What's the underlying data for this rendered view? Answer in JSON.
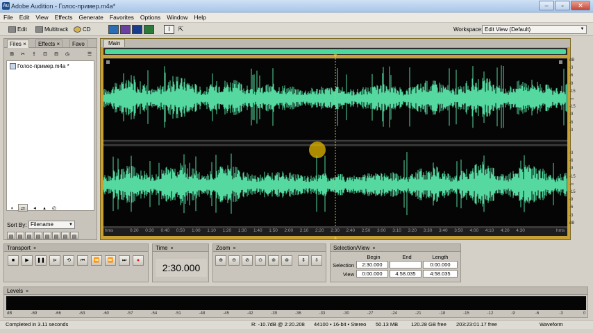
{
  "window": {
    "title": "Adobe Audition - Голос-пример.m4a*"
  },
  "menu": [
    "File",
    "Edit",
    "View",
    "Effects",
    "Generate",
    "Favorites",
    "Options",
    "Window",
    "Help"
  ],
  "toolbar": {
    "edit_label": "Edit",
    "multitrack_label": "Multitrack",
    "cd_label": "CD",
    "workspace_label": "Workspace:",
    "workspace_value": "Edit View (Default)"
  },
  "files_panel": {
    "tabs": [
      "Files",
      "Effects",
      "Favo"
    ],
    "file_name": "Голос-пример.m4a *",
    "sort_label": "Sort By:",
    "sort_value": "Filename"
  },
  "editor": {
    "tab_label": "Main",
    "ruler_unit": "hms",
    "ruler_ticks": [
      "0:20",
      "0:30",
      "0:40",
      "0:50",
      "1:00",
      "1:10",
      "1:20",
      "1:30",
      "1:40",
      "1:50",
      "2:00",
      "2:10",
      "2:20",
      "2:30",
      "2:40",
      "2:50",
      "3:00",
      "3:10",
      "3:20",
      "3:30",
      "3:40",
      "3:50",
      "4:00",
      "4:10",
      "4:20",
      "4:30"
    ],
    "db_labels_top": [
      "dB",
      "-3",
      "-6",
      "-9",
      "-15",
      "-∞",
      "-15",
      "-9",
      "-6",
      "-3"
    ],
    "db_labels_bottom": [
      "-3",
      "-6",
      "-9",
      "-15",
      "-∞",
      "-15",
      "-9",
      "-6",
      "-3",
      "dB"
    ]
  },
  "transport": {
    "title": "Transport"
  },
  "time_panel": {
    "title": "Time",
    "value": "2:30.000"
  },
  "zoom_panel": {
    "title": "Zoom"
  },
  "selection_panel": {
    "title": "Selection/View",
    "col_begin": "Begin",
    "col_end": "End",
    "col_length": "Length",
    "row_selection": "Selection",
    "row_view": "View",
    "selection_begin": "2:30.000",
    "selection_end": "",
    "selection_length": "0:00.000",
    "view_begin": "0:00.000",
    "view_end": "4:58.035",
    "view_length": "4:58.035"
  },
  "levels_panel": {
    "title": "Levels",
    "scale": [
      "dB",
      "-69",
      "-66",
      "-63",
      "-60",
      "-57",
      "-54",
      "-51",
      "-48",
      "-45",
      "-42",
      "-39",
      "-36",
      "-33",
      "-30",
      "-27",
      "-24",
      "-21",
      "-18",
      "-15",
      "-12",
      "-9",
      "-6",
      "-3",
      "0"
    ]
  },
  "status": {
    "message": "Completed in 3.11 seconds",
    "level": "R: -10.7dB @ 2:20.208",
    "format": "44100 • 16-bit • Stereo",
    "size": "50.13 MB",
    "free": "120.28 GB free",
    "free_time": "203:23:01.17 free",
    "view": "Waveform"
  },
  "colors": {
    "waveform": "#55d9a0",
    "editor_border": "#c8a236",
    "cursor": "#e6b800"
  }
}
